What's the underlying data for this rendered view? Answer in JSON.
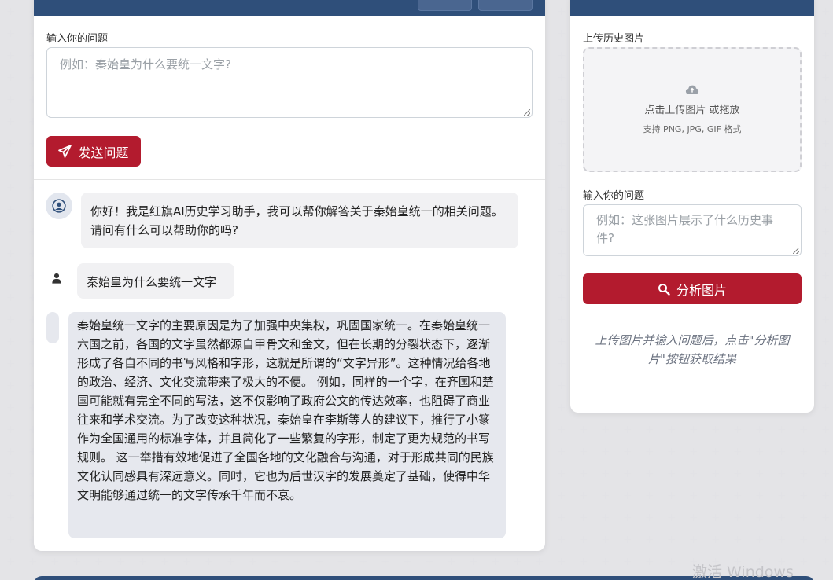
{
  "chat": {
    "question_label": "输入你的问题",
    "question_placeholder": "例如：秦始皇为什么要统一文字?",
    "send_label": "发送问题",
    "messages": [
      {
        "role": "assistant",
        "text": "你好！我是红旗AI历史学习助手，我可以帮你解答关于秦始皇统一的相关问题。请问有什么可以帮助你的吗?"
      },
      {
        "role": "user",
        "text": "秦始皇为什么要统一文字"
      },
      {
        "role": "assistant",
        "text": "秦始皇统一文字的主要原因是为了加强中央集权，巩固国家统一。在秦始皇统一六国之前，各国的文字虽然都源自甲骨文和金文，但在长期的分裂状态下，逐渐形成了各自不同的书写风格和字形，这就是所谓的“文字异形”。这种情况给各地的政治、经济、文化交流带来了极大的不便。 例如，同样的一个字，在齐国和楚国可能就有完全不同的写法，这不仅影响了政府公文的传达效率，也阻碍了商业往来和学术交流。为了改变这种状况，秦始皇在李斯等人的建议下，推行了小篆作为全国通用的标准字体，并且简化了一些繁复的字形，制定了更为规范的书写规则。 这一举措有效地促进了全国各地的文化融合与沟通，对于形成共同的民族文化认同感具有深远意义。同时，它也为后世汉字的发展奠定了基础，使得中华文明能够通过统一的文字传承千年而不衰。"
      }
    ]
  },
  "image_panel": {
    "upload_label": "上传历史图片",
    "upload_main": "点击上传图片 或拖放",
    "upload_sub": "支持 PNG, JPG, GIF 格式",
    "question_label": "输入你的问题",
    "question_placeholder": "例如：这张图片展示了什么历史事件?",
    "analyze_label": "分析图片",
    "hint": "上传图片并输入问题后，点击\"分析图片\"按钮获取结果"
  },
  "watermark": "激活 Windows",
  "colors": {
    "primary": "#b31b2e",
    "header": "#2f4f7a"
  }
}
